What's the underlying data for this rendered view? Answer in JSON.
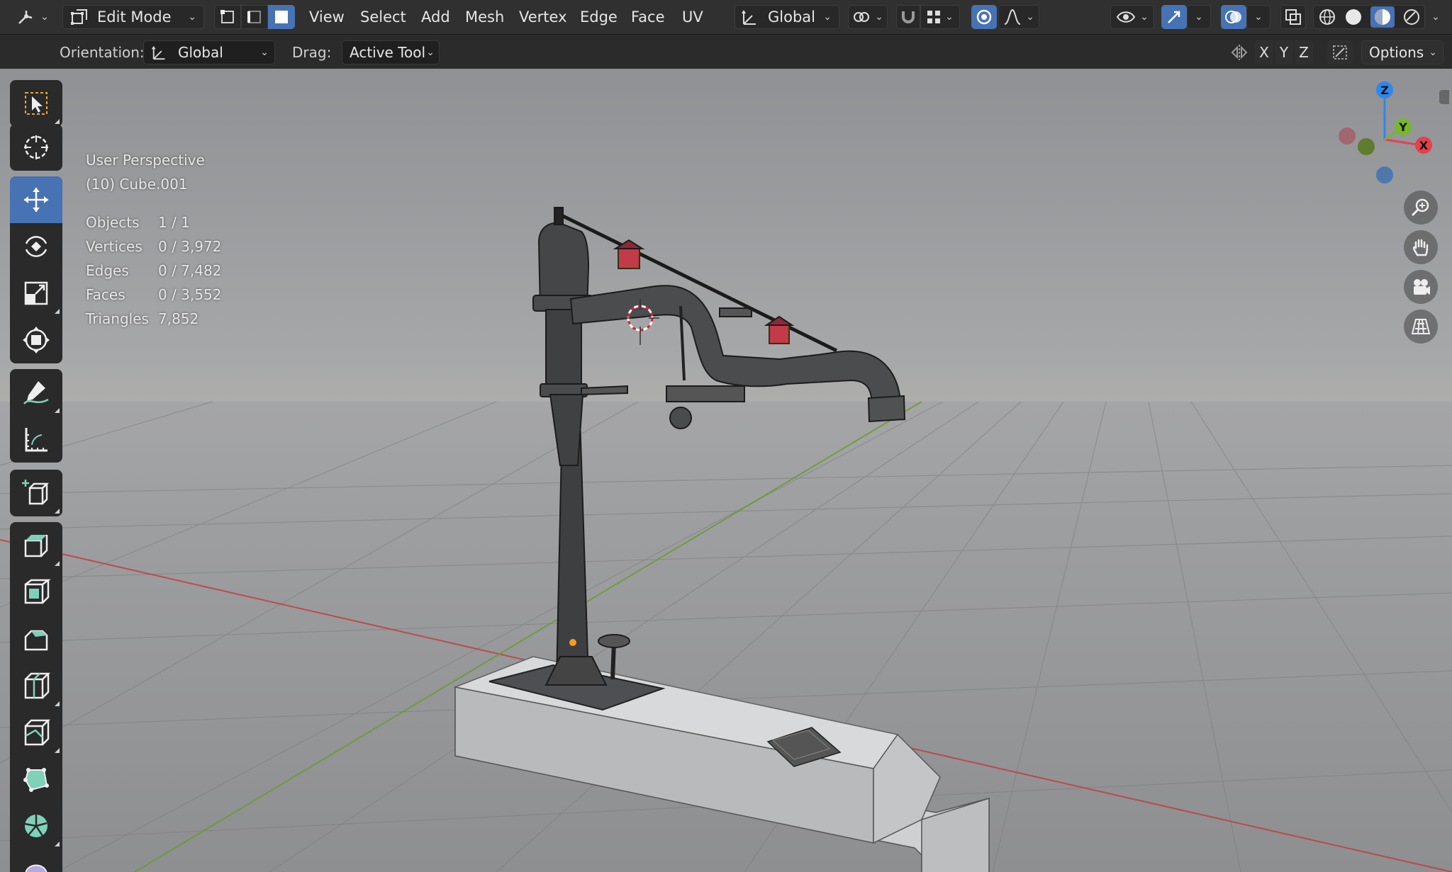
{
  "header": {
    "editor_type_icon": "transform-gizmo-icon",
    "mode": {
      "label": "Edit Mode",
      "icon": "edit-mode-icon"
    },
    "select_modes": [
      {
        "name": "vertex-select-mode",
        "active": false
      },
      {
        "name": "edge-select-mode",
        "active": false
      },
      {
        "name": "face-select-mode",
        "active": true
      }
    ],
    "menus": [
      "View",
      "Select",
      "Add",
      "Mesh",
      "Vertex",
      "Edge",
      "Face",
      "UV"
    ],
    "transform_orientation": {
      "label": "Global",
      "icon": "orientation-icon"
    },
    "pivot_icon": "pivot-point-icon",
    "snap_icon": "magnet-snap-icon",
    "snap_target_icon": "snap-grid-icon",
    "proportional_icon": "proportional-edit-icon",
    "falloff_icon": "falloff-curve-icon",
    "visibility_icon": "eye-icon",
    "gizmo_icon": "gizmo-arrow-icon",
    "overlay_icon": "overlay-icon",
    "xray_icon": "xray-icon",
    "shading_modes": [
      "wireframe",
      "solid",
      "material-preview",
      "rendered"
    ]
  },
  "tool_settings": {
    "orientation_label": "Orientation:",
    "orientation_value": "Global",
    "drag_label": "Drag:",
    "drag_value": "Active Tool",
    "axis_x": "X",
    "axis_y": "Y",
    "axis_z": "Z",
    "options_label": "Options"
  },
  "toolbar": {
    "tools": [
      "select-box",
      "cursor",
      "move",
      "rotate",
      "scale",
      "transform",
      "annotate",
      "measure",
      "add-cube",
      "extrude-region",
      "inset-faces",
      "bevel",
      "loop-cut",
      "knife",
      "poly-build",
      "spin",
      "smooth"
    ],
    "active": "move"
  },
  "viewport": {
    "view_name": "User Perspective",
    "object_name": "(10) Cube.001",
    "stats": [
      {
        "label": "Objects",
        "value": "1 / 1"
      },
      {
        "label": "Vertices",
        "value": "0 / 3,972"
      },
      {
        "label": "Edges",
        "value": "0 / 7,482"
      },
      {
        "label": "Faces",
        "value": "0 / 3,552"
      },
      {
        "label": "Triangles",
        "value": "7,852"
      }
    ],
    "gizmo": {
      "x": "X",
      "y": "Y",
      "z": "Z",
      "colors": {
        "x": "#e5404e",
        "y": "#76b82a",
        "z": "#2e87ed"
      }
    },
    "nav_buttons": [
      "zoom-icon",
      "hand-pan-icon",
      "camera-icon",
      "grid-ortho-icon"
    ]
  },
  "colors": {
    "accent": "#4772b3",
    "header": "#303030",
    "axis_red": "#c43a3a",
    "axis_green": "#6a9a2a"
  }
}
